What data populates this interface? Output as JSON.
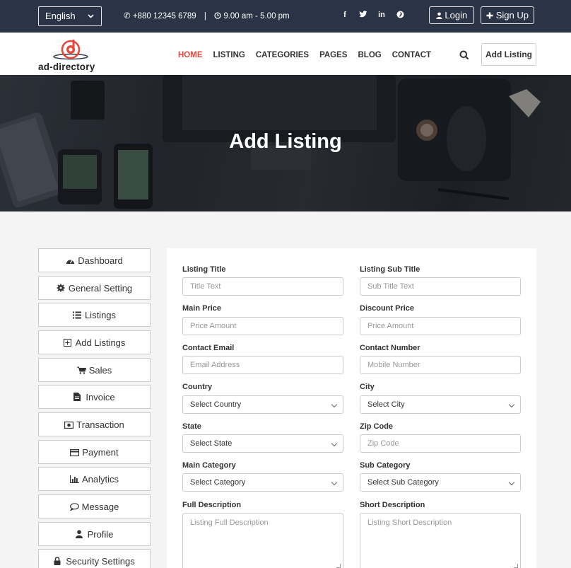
{
  "topbar": {
    "language": "English",
    "phone": "+880 12345 6789",
    "separator": "|",
    "hours": "9.00 am - 5.00 pm",
    "login_label": "Login",
    "signup_label": "Sign Up"
  },
  "nav": {
    "logo_text": "ad-directory",
    "items": [
      {
        "label": "HOME",
        "active": true
      },
      {
        "label": "LISTING"
      },
      {
        "label": "CATEGORIES"
      },
      {
        "label": "PAGES"
      },
      {
        "label": "BLOG"
      },
      {
        "label": "CONTACT"
      }
    ],
    "add_listing_label": "Add Listing"
  },
  "hero": {
    "title": "Add Listing"
  },
  "sidebar": {
    "items": [
      {
        "label": "Dashboard",
        "icon": "dashboard-icon"
      },
      {
        "label": "General Setting",
        "icon": "gear-icon"
      },
      {
        "label": "Listings",
        "icon": "list-icon"
      },
      {
        "label": "Add Listings",
        "icon": "plus-square-icon"
      },
      {
        "label": "Sales",
        "icon": "cart-icon"
      },
      {
        "label": "Invoice",
        "icon": "file-icon"
      },
      {
        "label": "Transaction",
        "icon": "money-icon"
      },
      {
        "label": "Payment",
        "icon": "credit-card-icon"
      },
      {
        "label": "Analytics",
        "icon": "bar-chart-icon"
      },
      {
        "label": "Message",
        "icon": "comment-icon"
      },
      {
        "label": "Profile",
        "icon": "user-icon"
      },
      {
        "label": "Security Settings",
        "icon": "lock-icon"
      }
    ]
  },
  "form": {
    "listing_title": {
      "label": "Listing Title",
      "placeholder": "Title Text"
    },
    "listing_sub_title": {
      "label": "Listing Sub Title",
      "placeholder": "Sub Title Text"
    },
    "main_price": {
      "label": "Main Price",
      "placeholder": "Price Amount"
    },
    "discount_price": {
      "label": "Discount Price",
      "placeholder": "Price Amount"
    },
    "contact_email": {
      "label": "Contact Email",
      "placeholder": "Email Address"
    },
    "contact_number": {
      "label": "Contact Number",
      "placeholder": "Mobile Number"
    },
    "country": {
      "label": "Country",
      "value": "Select Country"
    },
    "city": {
      "label": "City",
      "value": "Select City"
    },
    "state": {
      "label": "State",
      "value": "Select State"
    },
    "zip_code": {
      "label": "Zip Code",
      "placeholder": "Zip Code"
    },
    "main_category": {
      "label": "Main Category",
      "value": "Select Category"
    },
    "sub_category": {
      "label": "Sub Category",
      "value": "Select Sub Category"
    },
    "full_description": {
      "label": "Full Description",
      "placeholder": "Listing Full Description"
    },
    "short_description": {
      "label": "Short Description",
      "placeholder": "Listing Short Description"
    }
  },
  "colors": {
    "topbar": "#2b3446",
    "accent": "#e8473a"
  }
}
